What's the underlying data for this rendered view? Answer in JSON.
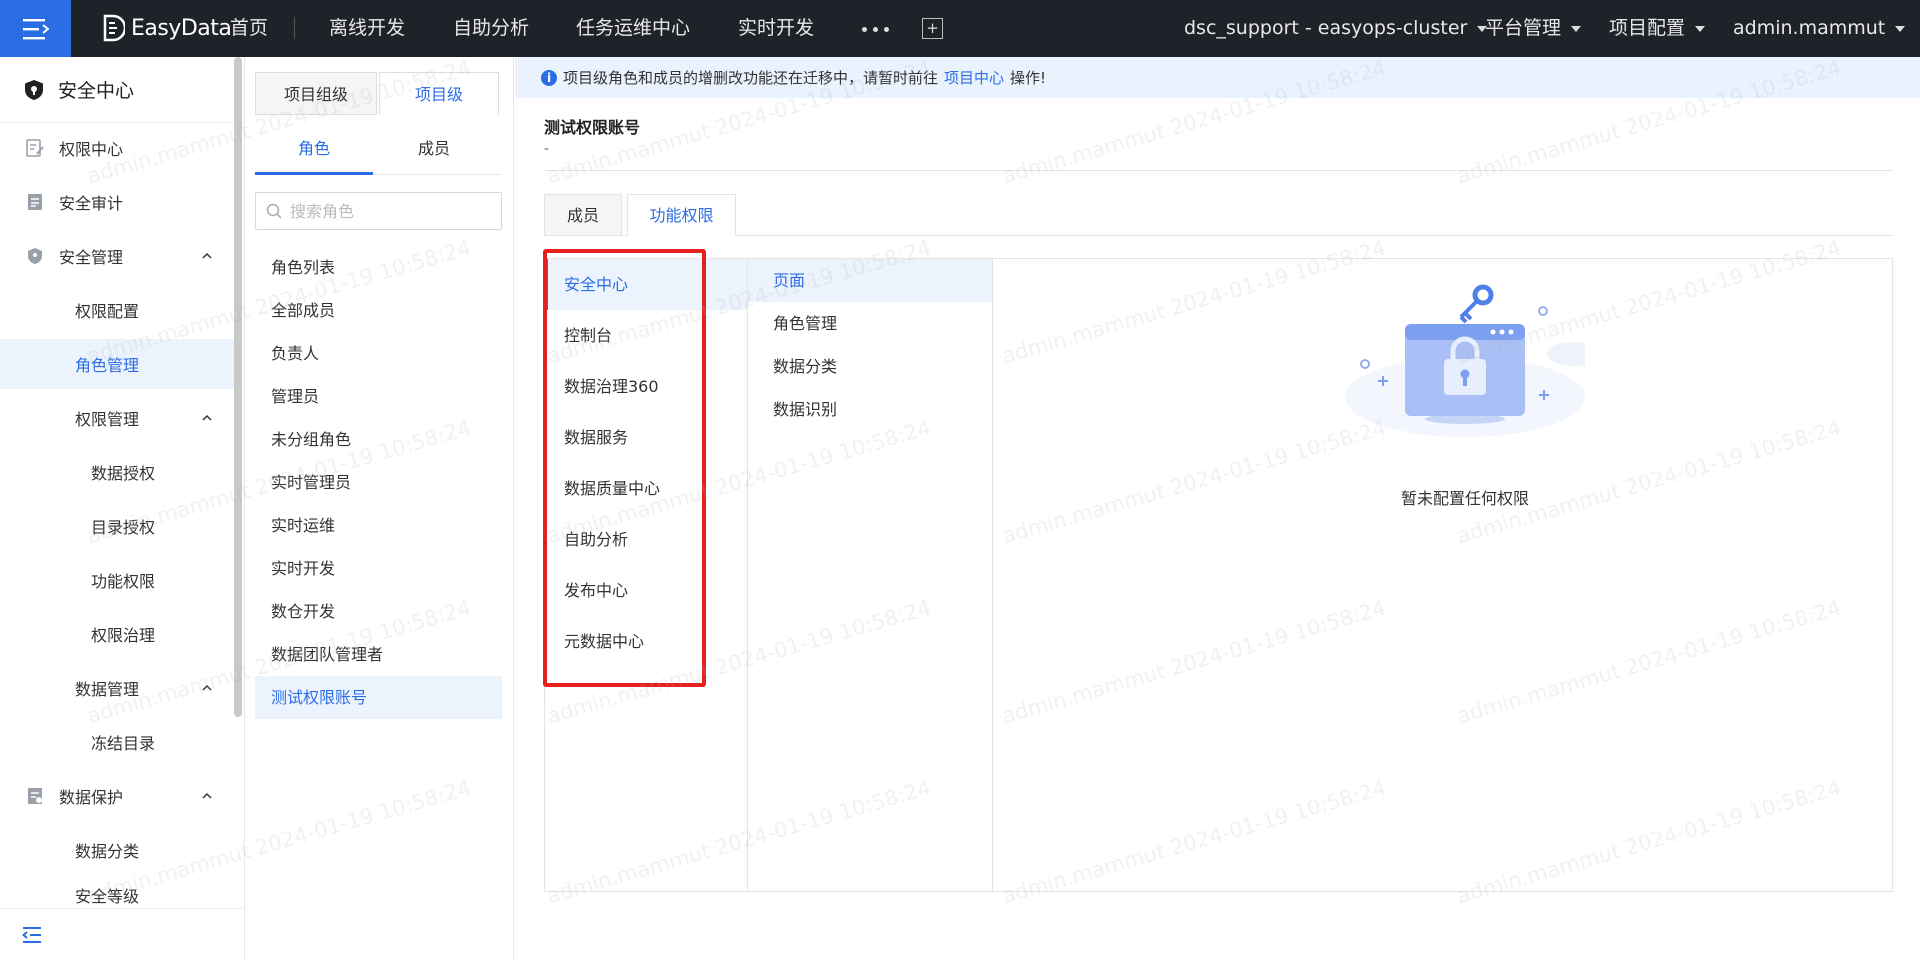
{
  "topbar": {
    "brand": "EasyData",
    "nav": [
      "首页",
      "离线开发",
      "自助分析",
      "任务运维中心",
      "实时开发"
    ],
    "cluster": "dsc_support - easyops-cluster",
    "platform_mgmt": "平台管理",
    "project_config": "项目配置",
    "user": "admin.mammut"
  },
  "sidebar": {
    "header": "安全中心",
    "items": [
      {
        "label": "权限中心",
        "icon": "permission-edit-icon"
      },
      {
        "label": "安全审计",
        "icon": "audit-doc-icon"
      },
      {
        "label": "安全管理",
        "icon": "shield-icon",
        "expanded": true
      },
      {
        "label": "权限配置"
      },
      {
        "label": "角色管理",
        "active": true
      },
      {
        "label": "权限管理",
        "expanded": true
      },
      {
        "label": "数据授权"
      },
      {
        "label": "目录授权"
      },
      {
        "label": "功能权限"
      },
      {
        "label": "权限治理"
      },
      {
        "label": "数据管理",
        "expanded": true
      },
      {
        "label": "冻结目录"
      },
      {
        "label": "数据保护",
        "icon": "data-protect-icon",
        "expanded": true
      },
      {
        "label": "数据分类"
      },
      {
        "label": "安全等级"
      }
    ]
  },
  "midpanel": {
    "tabs": [
      "项目组级",
      "项目级"
    ],
    "subtabs": [
      "角色",
      "成员"
    ],
    "search_placeholder": "搜索角色",
    "roles": [
      "角色列表",
      "全部成员",
      "负责人",
      "管理员",
      "未分组角色",
      "实时管理员",
      "实时运维",
      "实时开发",
      "数仓开发",
      "数据团队管理者",
      "测试权限账号"
    ]
  },
  "main": {
    "notice_text": "项目级角色和成员的增删改功能还在迁移中，请暂时前往",
    "notice_link": "项目中心",
    "notice_tail": "操作!",
    "title": "测试权限账号",
    "subtitle": "-",
    "tabs": [
      "成员",
      "功能权限"
    ],
    "modules": [
      "安全中心",
      "控制台",
      "数据治理360",
      "数据服务",
      "数据质量中心",
      "自助分析",
      "发布中心",
      "元数据中心"
    ],
    "pages": [
      "页面",
      "角色管理",
      "数据分类",
      "数据识别"
    ],
    "empty_text": "暂未配置任何权限"
  },
  "watermark": "admin.mammut 2024-01-19 10:58:24",
  "colors": {
    "accent": "#2b6de5",
    "topbar": "#1f2229",
    "highlight": "#e5211f"
  }
}
